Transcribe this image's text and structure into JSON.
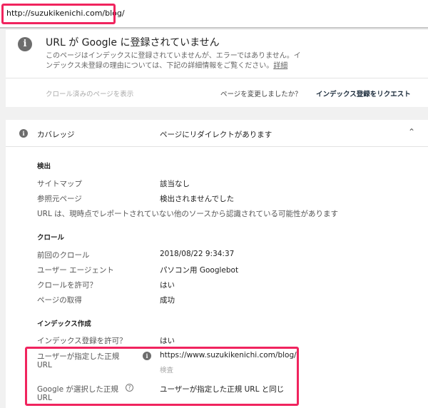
{
  "url_bar": {
    "value": "http://suzukikenichi.com/blog/"
  },
  "status": {
    "title": "URL が Google に登録されていません",
    "desc1": "このページはインデックスに登録されていませんが、エラーではありません。イ",
    "desc2": "ンデックス未登録の理由については、下記の詳細情報をご覧ください。",
    "link": "詳細",
    "view_crawled": "クロール済みのページを表示",
    "changed_q": "ページを変更しましたか？",
    "request": "インデックス登録をリクエスト"
  },
  "coverage": {
    "label": "カバレッジ",
    "value": "ページにリダイレクトがあります",
    "discovery": {
      "heading": "検出",
      "rows": [
        {
          "k": "サイトマップ",
          "v": "該当なし"
        },
        {
          "k": "参照元ページ",
          "v": "検出されませんでした"
        }
      ],
      "note": "URL は、現時点でレポートされていない他のソースから認識されている可能性があります"
    },
    "crawl": {
      "heading": "クロール",
      "rows": [
        {
          "k": "前回のクロール",
          "v": "2018/08/22 9:34:37"
        },
        {
          "k": "ユーザー エージェント",
          "v": "パソコン用 Googlebot"
        },
        {
          "k": "クロールを許可？",
          "v": "はい"
        },
        {
          "k": "ページの取得",
          "v": "成功"
        }
      ]
    },
    "indexing": {
      "heading": "インデックス作成",
      "allow_k": "インデックス登録を許可？",
      "allow_v": "はい",
      "user_canon_k1": "ユーザーが指定した正規",
      "user_canon_k2": "URL",
      "user_canon_v": "https://www.suzukikenichi.com/blog/",
      "inspect": "検査",
      "google_canon_k1": "Google が選択した正規",
      "google_canon_k2": "URL",
      "google_canon_v": "ユーザーが指定した正規 URL と同じ"
    }
  },
  "colors": {
    "highlight": "#f0245e"
  }
}
